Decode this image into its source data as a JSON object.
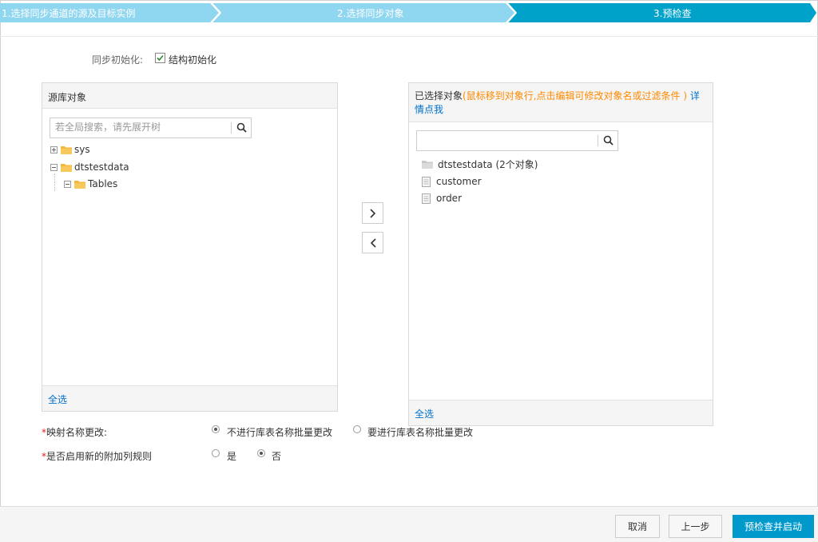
{
  "steps": [
    {
      "label": "1.选择同步通道的源及目标实例",
      "state": "done"
    },
    {
      "label": "2.选择同步对象",
      "state": "done"
    },
    {
      "label": "3.预检查",
      "state": "active"
    }
  ],
  "colors": {
    "step_done": "#8fd6f0",
    "step_active": "#00a2ca",
    "link": "#0070cc",
    "hint": "#ff8a00",
    "primary": "#0099cc"
  },
  "sync_init": {
    "label": "同步初始化:",
    "option_label": "结构初始化",
    "checked": true
  },
  "source_panel": {
    "title": "源库对象",
    "search_placeholder": "若全局搜索，请先展开树",
    "tree": [
      {
        "label": "sys",
        "expanded": false
      },
      {
        "label": "dtstestdata",
        "expanded": true,
        "children": [
          {
            "label": "Tables",
            "expanded": true
          }
        ]
      }
    ],
    "select_all": "全选"
  },
  "selected_panel": {
    "title": "已选择对象",
    "hint": "(鼠标移到对象行,点击编辑可修改对象名或过滤条件 )",
    "detail_link": "详情点我",
    "search_value": "",
    "group": "dtstestdata (2个对象)",
    "items": [
      "customer",
      "order"
    ],
    "select_all": "全选"
  },
  "move_buttons": {
    "right": "chevron-right-icon",
    "left": "chevron-left-icon"
  },
  "mapping": {
    "label": "映射名称更改:",
    "options": [
      {
        "label": "不进行库表名称批量更改",
        "selected": true
      },
      {
        "label": "要进行库表名称批量更改",
        "selected": false
      }
    ]
  },
  "extra_column": {
    "label": "是否启用新的附加列规则",
    "options": [
      {
        "label": "是",
        "selected": false
      },
      {
        "label": "否",
        "selected": true
      }
    ]
  },
  "footer": {
    "cancel": "取消",
    "prev": "上一步",
    "submit": "预检查并启动"
  }
}
